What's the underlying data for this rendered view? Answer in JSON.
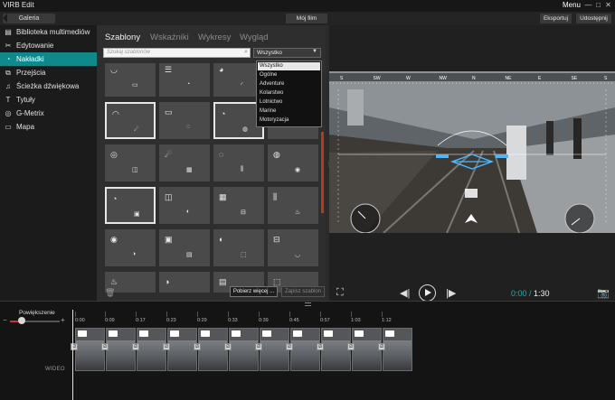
{
  "app": {
    "title": "VIRB Edit",
    "menu_label": "Menu"
  },
  "window_controls": [
    "—",
    "□",
    "✕"
  ],
  "toolbar": {
    "gallery_label": "Galeria",
    "project_label": "Mój film",
    "export_label": "Eksportuj",
    "share_label": "Udostępnij"
  },
  "sidebar": {
    "items": [
      {
        "label": "Biblioteka multimediów",
        "icon": "media-library-icon",
        "glyph": "▤",
        "active": false
      },
      {
        "label": "Edytowanie",
        "icon": "scissors-icon",
        "glyph": "✂",
        "active": false
      },
      {
        "label": "Nakładki",
        "icon": "gauge-icon",
        "glyph": "◔",
        "active": true
      },
      {
        "label": "Przejścia",
        "icon": "transitions-icon",
        "glyph": "⧉",
        "active": false
      },
      {
        "label": "Ścieżka dźwiękowa",
        "icon": "music-icon",
        "glyph": "♫",
        "active": false
      },
      {
        "label": "Tytuły",
        "icon": "text-icon",
        "glyph": "T",
        "active": false
      },
      {
        "label": "G-Metrix",
        "icon": "gmetrix-icon",
        "glyph": "◎",
        "active": false
      },
      {
        "label": "Mapa",
        "icon": "map-icon",
        "glyph": "▭",
        "active": false
      }
    ]
  },
  "library": {
    "tabs": [
      {
        "label": "Szablony",
        "active": true
      },
      {
        "label": "Wskaźniki",
        "active": false
      },
      {
        "label": "Wykresy",
        "active": false
      },
      {
        "label": "Wygląd",
        "active": false
      }
    ],
    "search_placeholder": "Szukaj szablonów",
    "filter_value": "Wszystko",
    "filter_options": [
      {
        "label": "Wszystko",
        "selected": true
      },
      {
        "label": "Ogólne",
        "selected": false
      },
      {
        "label": "Adventure",
        "selected": false
      },
      {
        "label": "Kolarstwo",
        "selected": false
      },
      {
        "label": "Lotnictwo",
        "selected": false
      },
      {
        "label": "Marine",
        "selected": false
      },
      {
        "label": "Motoryzacja",
        "selected": false
      }
    ],
    "get_more_label": "Pobierz więcej ...",
    "save_template_label": "Zapisz szablon"
  },
  "preview": {
    "compass_labels": [
      "S",
      "SW",
      "W",
      "NW",
      "N",
      "NE",
      "E",
      "SE",
      "S"
    ],
    "time_current": "0:00",
    "time_total": "1:30"
  },
  "timeline": {
    "zoom_label": "Powiększenie",
    "zoom_level": 0.2,
    "ticks": [
      "0:00",
      "0:09",
      "0:17",
      "0:23",
      "0:29",
      "0:33",
      "0:39",
      "0:45",
      "0:57",
      "1:03",
      "1:12"
    ],
    "track_label": "WIDEO",
    "clip_count": 11
  }
}
